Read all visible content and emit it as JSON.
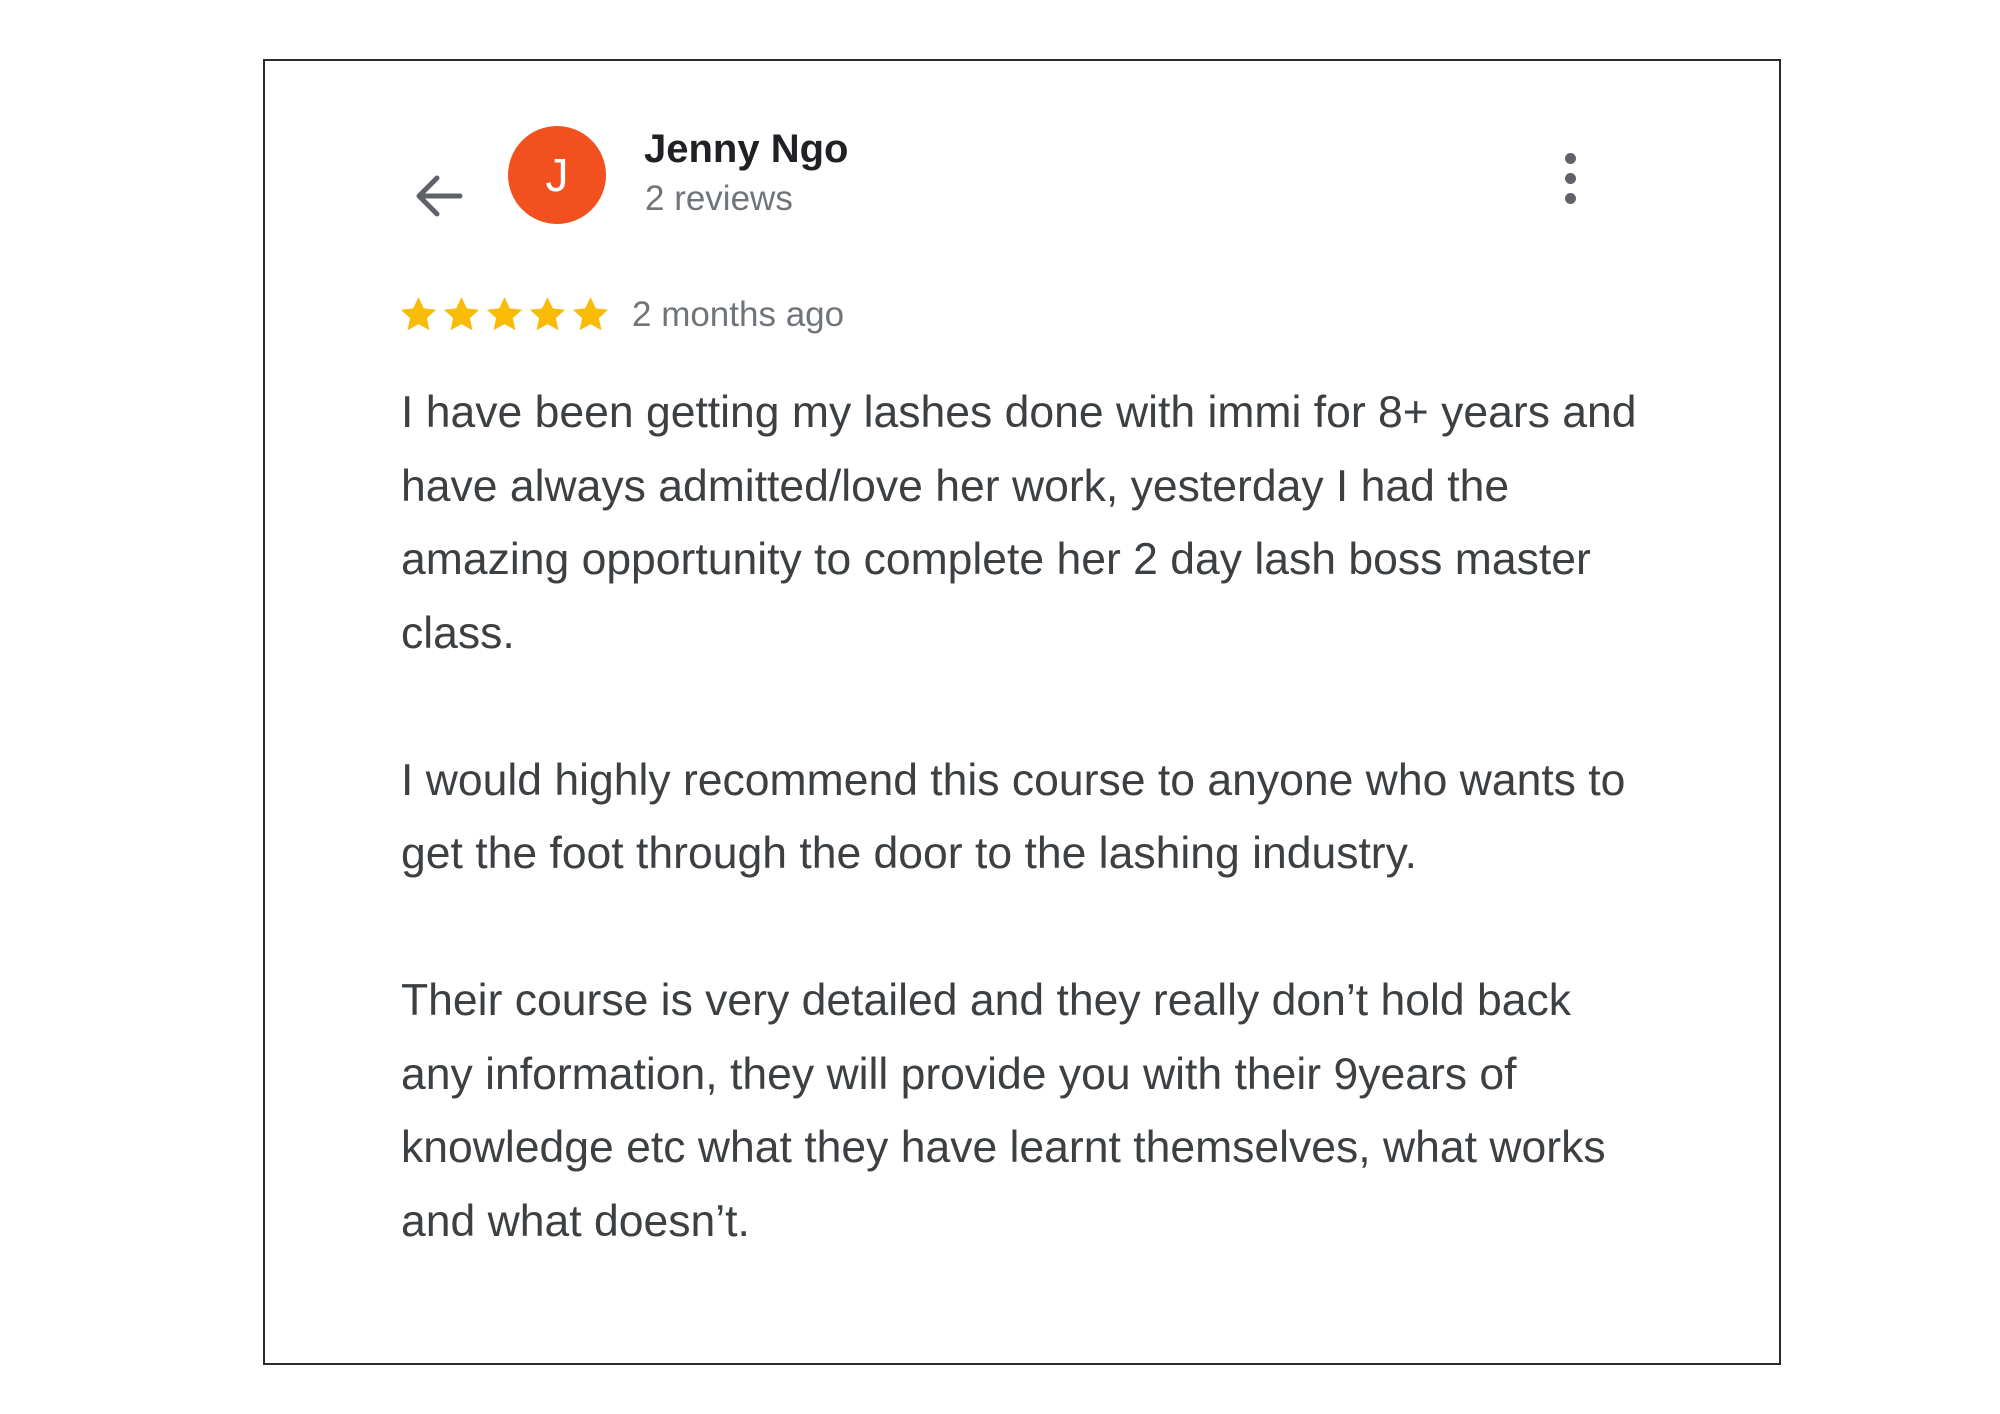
{
  "colors": {
    "avatar_bg": "#f2501e",
    "star": "#f9bb05",
    "icon": "#5f6368"
  },
  "header": {
    "back_icon": "arrow-left-icon",
    "avatar_initial": "J",
    "reviewer_name": "Jenny Ngo",
    "review_count": "2 reviews",
    "more_icon": "more-vertical-icon"
  },
  "review": {
    "rating": 5,
    "rating_max": 5,
    "time": "2 months ago",
    "paragraphs": [
      "I have been getting my lashes done with immi for 8+ years and have always admitted/love her work, yesterday I had the amazing opportunity to complete her 2 day lash boss master class.",
      "I would highly recommend this course to anyone who wants to get the foot through the door to the lashing industry.",
      "Their course is very detailed and they really don’t hold back any information, they will provide you with their 9years of knowledge etc what they have learnt themselves, what works and what doesn’t."
    ]
  }
}
